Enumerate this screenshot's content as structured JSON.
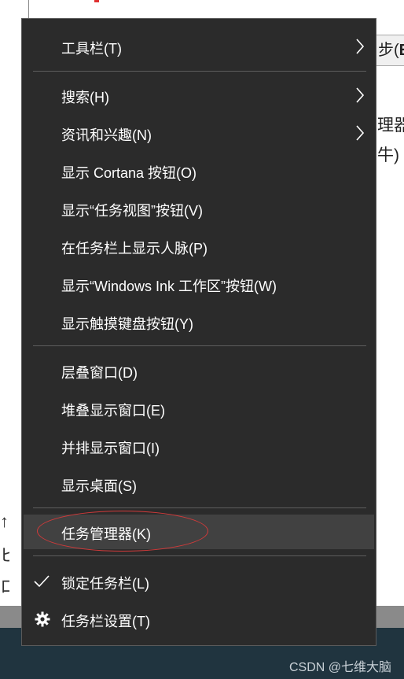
{
  "background": {
    "field_text_prefix": "步(",
    "field_text_bold": "E",
    "right_text_1": "理器",
    "right_text_2": "牛)",
    "watermark": "CSDN @七维大脑"
  },
  "menu": {
    "items": [
      {
        "label": "工具栏(T)",
        "has_submenu": true
      },
      {
        "label": "搜索(H)",
        "has_submenu": true
      },
      {
        "label": "资讯和兴趣(N)",
        "has_submenu": true
      },
      {
        "label": "显示 Cortana 按钮(O)"
      },
      {
        "label": "显示“任务视图”按钮(V)"
      },
      {
        "label": "在任务栏上显示人脉(P)"
      },
      {
        "label": "显示“Windows Ink 工作区”按钮(W)"
      },
      {
        "label": "显示触摸键盘按钮(Y)"
      },
      {
        "label": "层叠窗口(D)"
      },
      {
        "label": "堆叠显示窗口(E)"
      },
      {
        "label": "并排显示窗口(I)"
      },
      {
        "label": "显示桌面(S)"
      },
      {
        "label": "任务管理器(K)",
        "highlighted": true,
        "annotation": "red-ellipse"
      },
      {
        "label": "锁定任务栏(L)",
        "checked": true,
        "icon": "check-icon"
      },
      {
        "label": "任务栏设置(T)",
        "icon": "gear-icon"
      }
    ],
    "colors": {
      "background": "#2b2b2b",
      "hover": "#414141",
      "separator": "#5d5d5d",
      "text": "#ffffff",
      "annotation": "#d33a3a"
    }
  }
}
